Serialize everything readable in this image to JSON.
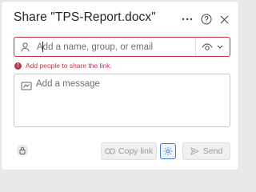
{
  "dialog": {
    "title": "Share \"TPS-Report.docx\"",
    "header_icons": [
      "more-icon",
      "help-icon",
      "close-icon"
    ]
  },
  "people_field": {
    "placeholder": "Add a name, group, or email",
    "value": "",
    "icon": "person-icon",
    "permission_icon": "eye-icon"
  },
  "error": {
    "text": "Add people to share the link.",
    "color": "#c4314b"
  },
  "message": {
    "placeholder": "Add a message",
    "icon": "message-icon"
  },
  "footer": {
    "copy_link_label": "Copy link",
    "send_label": "Send",
    "accent": "#3a7bd5"
  }
}
